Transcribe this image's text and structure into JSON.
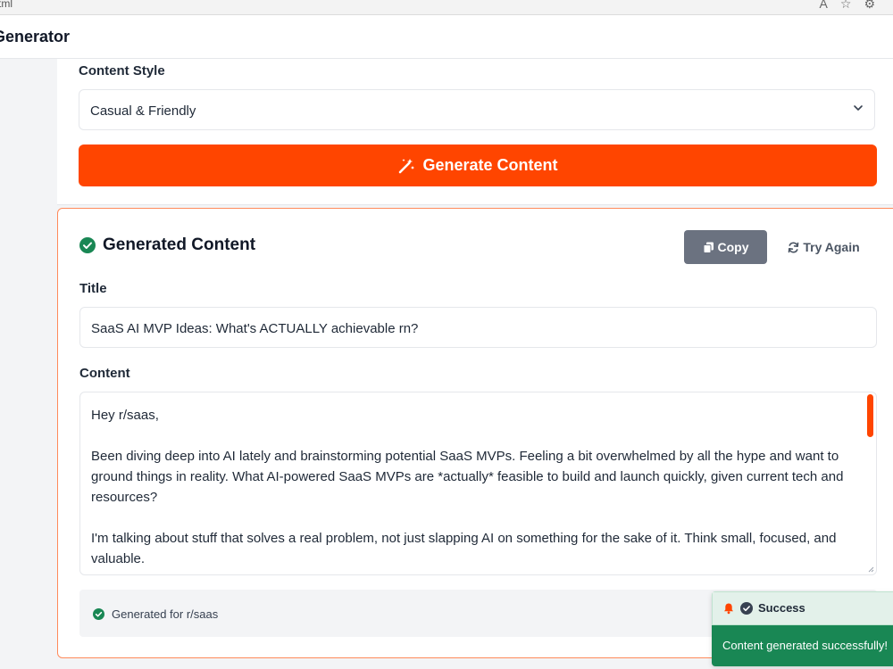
{
  "browser": {
    "url_fragment": "tml",
    "icons": [
      "font-size-icon",
      "star-icon",
      "gear-icon"
    ]
  },
  "app": {
    "title": "Generator"
  },
  "form": {
    "style_label": "Content Style",
    "style_selected": "Casual & Friendly",
    "generate_label": "Generate Content"
  },
  "result": {
    "heading": "Generated Content",
    "copy_label": "Copy",
    "try_again_label": "Try Again",
    "title_label": "Title",
    "title_value": "SaaS AI MVP Ideas: What's ACTUALLY achievable rn?",
    "content_label": "Content",
    "content_value": "Hey r/saas,\n\nBeen diving deep into AI lately and brainstorming potential SaaS MVPs. Feeling a bit overwhelmed by all the hype and want to ground things in reality. What AI-powered SaaS MVPs are *actually* feasible to build and launch quickly, given current tech and resources?\n\nI'm talking about stuff that solves a real problem, not just slapping AI on something for the sake of it. Think small, focused, and valuable.",
    "footer_text": "Generated for r/saas"
  },
  "toast": {
    "title": "Success",
    "message": "Content generated successfully!"
  },
  "colors": {
    "accent": "#ff4500",
    "success": "#198754",
    "secondary_button": "#6b7280"
  }
}
